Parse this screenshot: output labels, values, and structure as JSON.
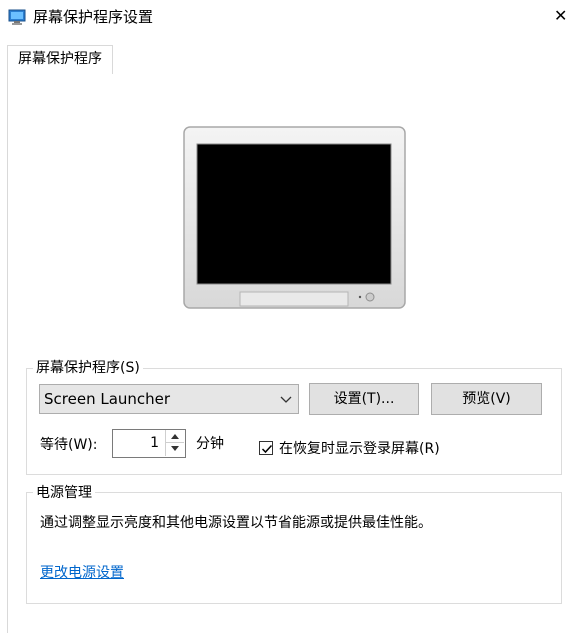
{
  "window": {
    "title": "屏幕保护程序设置",
    "close_glyph": "✕"
  },
  "tabs": [
    {
      "label": "屏幕保护程序"
    }
  ],
  "screensaver_group": {
    "legend": "屏幕保护程序(S)",
    "selected_screensaver": "Screen Launcher",
    "settings_button": "设置(T)...",
    "preview_button": "预览(V)",
    "wait_label": "等待(W):",
    "wait_value": "1",
    "wait_unit": "分钟",
    "resume_checkbox_label": "在恢复时显示登录屏幕(R)",
    "resume_checkbox_checked": true
  },
  "power_group": {
    "legend": "电源管理",
    "description": "通过调整显示亮度和其他电源设置以节省能源或提供最佳性能。",
    "link": "更改电源设置"
  },
  "colors": {
    "link": "#0066cc",
    "button_face": "#e1e1e1",
    "border": "#adadad"
  }
}
